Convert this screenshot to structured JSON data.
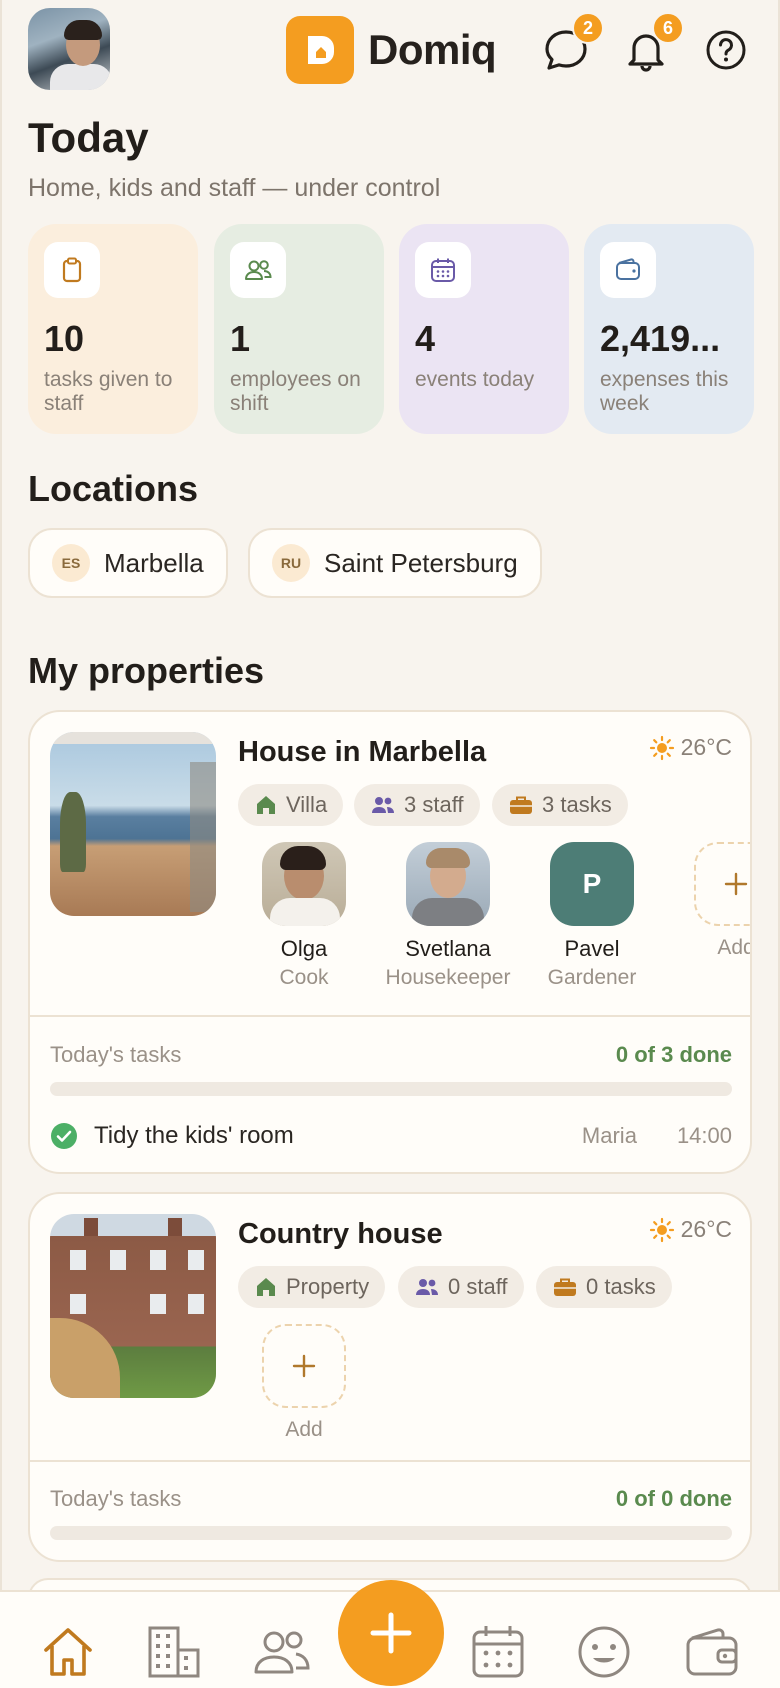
{
  "header": {
    "app_name": "Domiq",
    "messages_count": "2",
    "notifications_count": "6",
    "accent": "#f49d20"
  },
  "today": {
    "title": "Today",
    "subtitle": "Home, kids and staff — under control",
    "stats": [
      {
        "value": "10",
        "label": "tasks given to staff",
        "icon": "clipboard-icon",
        "bg": "#fbeedd"
      },
      {
        "value": "1",
        "label": "employees on shift",
        "icon": "people-icon",
        "bg": "#e6ede2"
      },
      {
        "value": "4",
        "label": "events today",
        "icon": "calendar-icon",
        "bg": "#ebe4f3"
      },
      {
        "value": "2,419...",
        "label": "expenses this week",
        "icon": "wallet-icon",
        "bg": "#e3eaf2"
      }
    ]
  },
  "locations": {
    "title": "Locations",
    "items": [
      {
        "code": "ES",
        "name": "Marbella"
      },
      {
        "code": "RU",
        "name": "Saint Petersburg"
      }
    ]
  },
  "properties": {
    "title": "My properties",
    "items": [
      {
        "name": "House in Marbella",
        "weather": "26°C",
        "type": "Villa",
        "staff_count": "3 staff",
        "tasks_count": "3 tasks",
        "staff": [
          {
            "name": "Olga",
            "role": "Cook"
          },
          {
            "name": "Svetlana",
            "role": "Housekeeper"
          },
          {
            "name": "Pavel",
            "role": "Gardener",
            "initial": "P"
          }
        ],
        "add_label": "Add",
        "tasks_title": "Today's tasks",
        "tasks_done": "0 of 3 done",
        "progress": 0,
        "tasks": [
          {
            "title": "Tidy the kids' room",
            "assignee": "Maria",
            "time": "14:00"
          }
        ]
      },
      {
        "name": "Country house",
        "weather": "26°C",
        "type": "Property",
        "staff_count": "0 staff",
        "tasks_count": "0 tasks",
        "add_label": "Add",
        "tasks_title": "Today's tasks",
        "tasks_done": "0 of 0 done",
        "progress": 0
      }
    ]
  },
  "nav": {
    "items": [
      "home-icon",
      "buildings-icon",
      "staff-icon",
      "add-icon",
      "calendar-icon",
      "kids-icon",
      "wallet-icon"
    ]
  }
}
